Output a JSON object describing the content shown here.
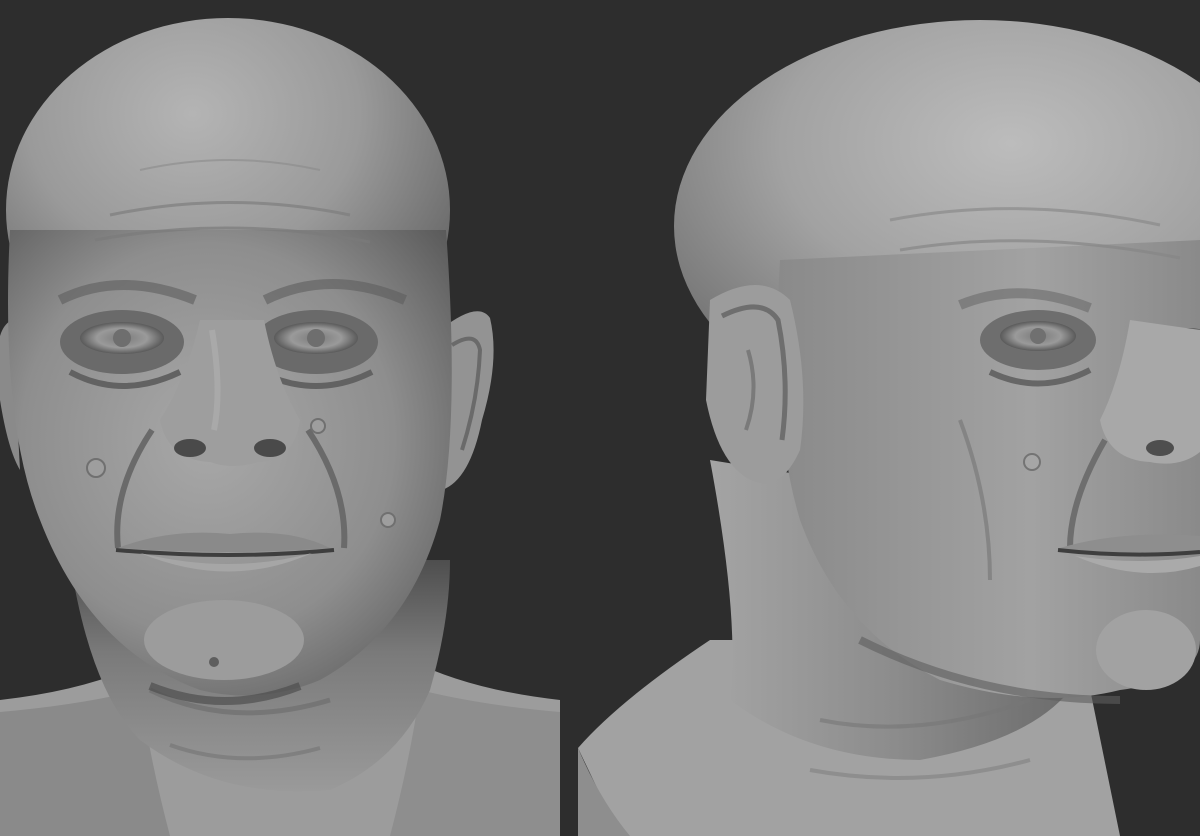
{
  "scene": {
    "background_color": "#2d2d2d",
    "clay_color": "#8c8c8c",
    "views": [
      {
        "name": "front-view"
      },
      {
        "name": "three-quarter-view"
      }
    ]
  }
}
